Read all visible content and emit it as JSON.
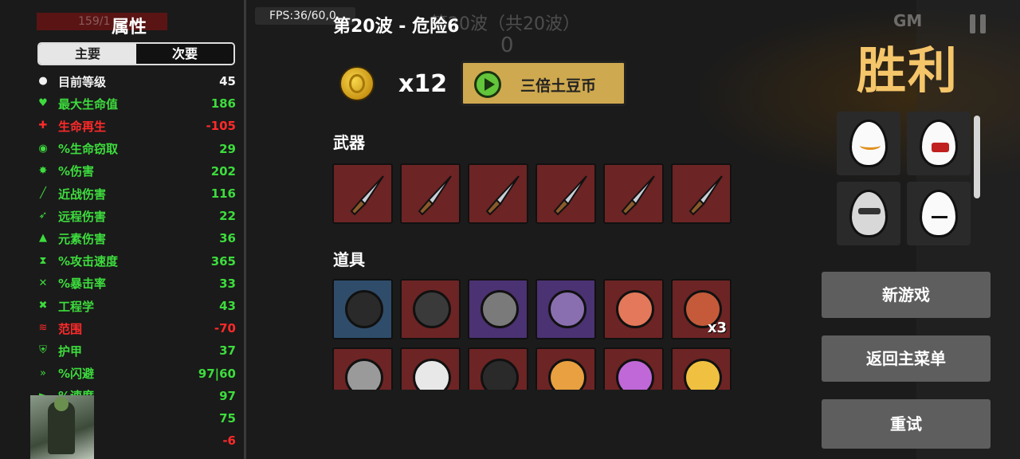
{
  "hud": {
    "fps": "FPS:36/60,0",
    "gm": "GM",
    "ghost_wave": "第20波（共20波）",
    "ghost_zero": "0",
    "ghost_hp": "159/1"
  },
  "stats": {
    "title": "属性",
    "tabs": [
      {
        "label": "主要",
        "active": true
      },
      {
        "label": "次要",
        "active": false
      }
    ],
    "rows": [
      {
        "icon": "level-icon",
        "glyph": "●",
        "name": "目前等级",
        "value": "45",
        "color": "white"
      },
      {
        "icon": "heart-icon",
        "glyph": "♥",
        "name": "最大生命值",
        "value": "186",
        "color": "green"
      },
      {
        "icon": "regen-icon",
        "glyph": "✚",
        "name": "生命再生",
        "value": "-105",
        "color": "red"
      },
      {
        "icon": "lifesteal-icon",
        "glyph": "◉",
        "name": "%生命窃取",
        "value": "29",
        "color": "green"
      },
      {
        "icon": "damage-icon",
        "glyph": "✸",
        "name": "%伤害",
        "value": "202",
        "color": "green"
      },
      {
        "icon": "melee-icon",
        "glyph": "╱",
        "name": "近战伤害",
        "value": "116",
        "color": "green"
      },
      {
        "icon": "ranged-icon",
        "glyph": "➶",
        "name": "远程伤害",
        "value": "22",
        "color": "green"
      },
      {
        "icon": "elemental-icon",
        "glyph": "▲",
        "name": "元素伤害",
        "value": "36",
        "color": "green"
      },
      {
        "icon": "attack-speed-icon",
        "glyph": "⧗",
        "name": "%攻击速度",
        "value": "365",
        "color": "green"
      },
      {
        "icon": "crit-icon",
        "glyph": "✕",
        "name": "%暴击率",
        "value": "33",
        "color": "green"
      },
      {
        "icon": "engineering-icon",
        "glyph": "✖",
        "name": "工程学",
        "value": "43",
        "color": "green"
      },
      {
        "icon": "range-icon",
        "glyph": "≋",
        "name": "范围",
        "value": "-70",
        "color": "red"
      },
      {
        "icon": "armor-icon",
        "glyph": "⛨",
        "name": "护甲",
        "value": "37",
        "color": "green"
      },
      {
        "icon": "dodge-icon",
        "glyph": "»",
        "name": "%闪避",
        "value": "97|60",
        "color": "green"
      },
      {
        "icon": "speed-icon",
        "glyph": "►",
        "name": "%速度",
        "value": "97",
        "color": "green"
      },
      {
        "icon": "luck-icon",
        "glyph": "✿",
        "name": "",
        "value": "75",
        "color": "green"
      },
      {
        "icon": "harvest-icon",
        "glyph": "◆",
        "name": "",
        "value": "-6",
        "color": "red"
      }
    ]
  },
  "summary": {
    "wave_title": "第20波 - 危险6",
    "coin_count": "x12",
    "triple_label": "三倍土豆币",
    "weapons_label": "武器",
    "items_label": "道具",
    "weapon_count": 6,
    "items": [
      {
        "name": "helmet-item-icon",
        "tier": "blue",
        "color": "#2a2a2a",
        "badge": ""
      },
      {
        "name": "binoculars-item-icon",
        "tier": "red",
        "color": "#3a3a3a",
        "badge": ""
      },
      {
        "name": "robot-item-icon",
        "tier": "purple",
        "color": "#7a7a7a",
        "badge": ""
      },
      {
        "name": "creature-item-icon",
        "tier": "purple",
        "color": "#8a6fb0",
        "badge": ""
      },
      {
        "name": "octopus-item-icon",
        "tier": "red",
        "color": "#e3795a",
        "badge": ""
      },
      {
        "name": "rocket-item-icon",
        "tier": "red",
        "color": "#c45a3a",
        "badge": "x3"
      },
      {
        "name": "tools-item-icon",
        "tier": "red",
        "color": "#9a9a9a",
        "badge": ""
      },
      {
        "name": "spiky-item-icon",
        "tier": "red",
        "color": "#e8e8e8",
        "badge": ""
      },
      {
        "name": "mask-item-icon",
        "tier": "red",
        "color": "#2a2a2a",
        "badge": ""
      },
      {
        "name": "bullet-item-icon",
        "tier": "red",
        "color": "#e8a040",
        "badge": ""
      },
      {
        "name": "feather-item-icon",
        "tier": "red",
        "color": "#c068d8",
        "badge": ""
      },
      {
        "name": "explosion-item-icon",
        "tier": "red",
        "color": "#f0c040",
        "badge": ""
      }
    ]
  },
  "right": {
    "victory": "胜利",
    "buttons": {
      "new_game": "新游戏",
      "main_menu": "返回主菜单",
      "retry": "重试"
    }
  }
}
